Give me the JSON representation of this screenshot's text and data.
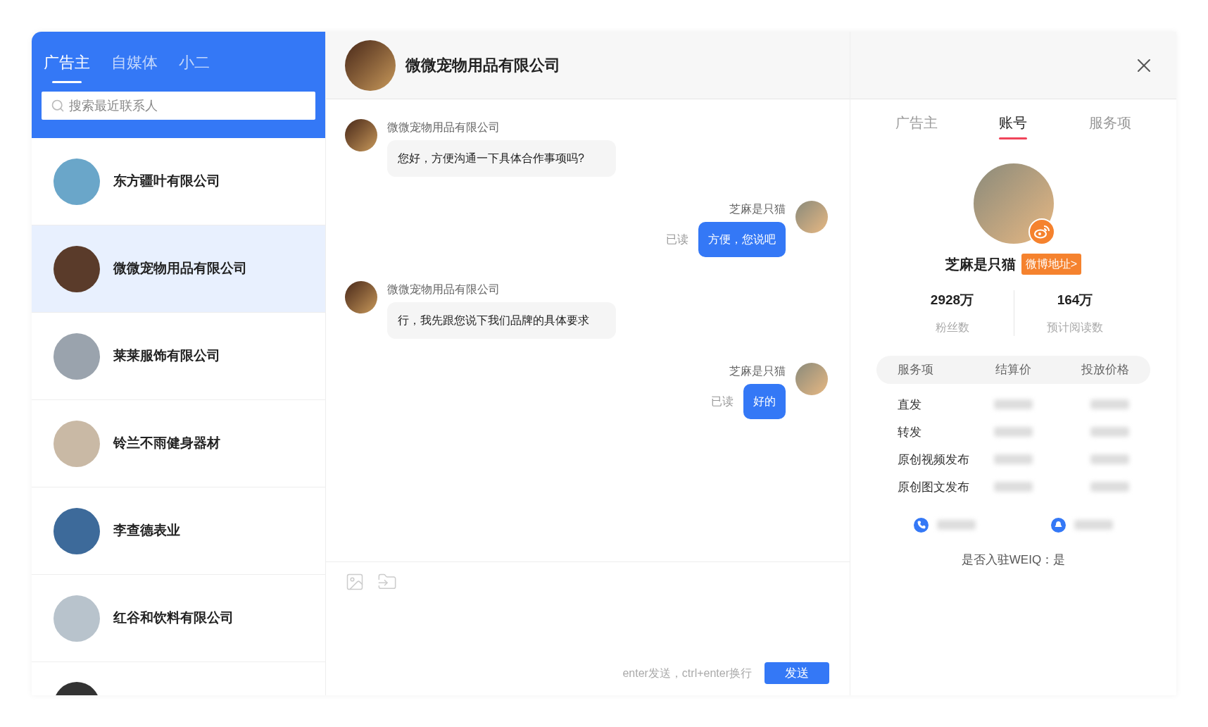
{
  "sidebar": {
    "tabs": [
      {
        "label": "广告主",
        "selected": true
      },
      {
        "label": "自媒体",
        "selected": false
      },
      {
        "label": "小二",
        "selected": false
      }
    ],
    "search": {
      "placeholder": "搜索最近联系人"
    },
    "contacts": [
      {
        "name": "东方疆叶有限公司",
        "selected": false
      },
      {
        "name": "微微宠物用品有限公司",
        "selected": true
      },
      {
        "name": "莱莱服饰有限公司",
        "selected": false
      },
      {
        "name": "铃兰不雨健身器材",
        "selected": false
      },
      {
        "name": "李查德表业",
        "selected": false
      },
      {
        "name": "红谷和饮料有限公司",
        "selected": false
      }
    ]
  },
  "chat": {
    "title": "微微宠物用品有限公司",
    "messages": [
      {
        "kind": "incoming",
        "sender": "微微宠物用品有限公司",
        "text": "您好，方便沟通一下具体合作事项吗?"
      },
      {
        "kind": "outgoing",
        "sender": "芝麻是只猫",
        "text": "方便，您说吧",
        "status": "已读"
      },
      {
        "kind": "incoming",
        "sender": "微微宠物用品有限公司",
        "text": "行，我先跟您说下我们品牌的具体要求"
      },
      {
        "kind": "outgoing",
        "sender": "芝麻是只猫",
        "text": "好的",
        "status": "已读"
      }
    ],
    "hint": "enter发送，ctrl+enter换行",
    "send": "发送"
  },
  "profile": {
    "tabs": [
      {
        "label": "广告主",
        "selected": false
      },
      {
        "label": "账号",
        "selected": true
      },
      {
        "label": "服务项",
        "selected": false
      }
    ],
    "name": "芝麻是只猫",
    "link": "微博地址>",
    "stats": [
      {
        "value": "2928万",
        "label": "粉丝数"
      },
      {
        "value": "164万",
        "label": "预计阅读数"
      }
    ],
    "columns": [
      "服务项",
      "结算价",
      "投放价格"
    ],
    "rows": [
      "直发",
      "转发",
      "原创视频发布",
      "原创图文发布"
    ],
    "weiq": "是否入驻WEIQ：是"
  }
}
